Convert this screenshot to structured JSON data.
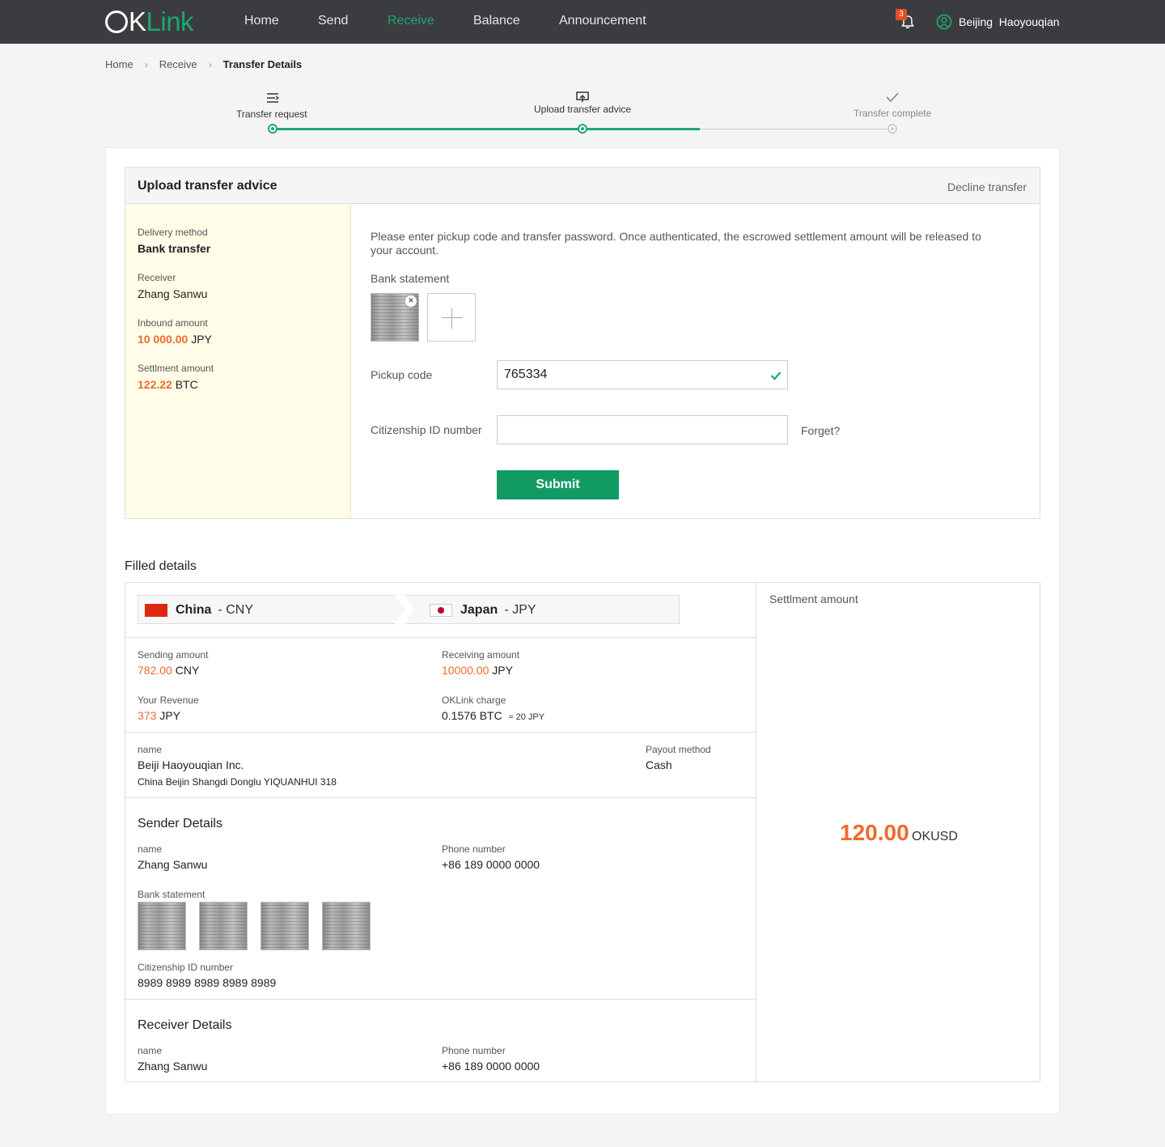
{
  "nav": {
    "logo": {
      "o": "O",
      "k": "K",
      "link": "Link"
    },
    "items": [
      "Home",
      "Send",
      "Receive",
      "Balance",
      "Announcement"
    ],
    "active_index": 2,
    "notification_count": "3",
    "user_name": "Beijing  Haoyouqian",
    "accent_color": "#1ea672"
  },
  "breadcrumb": {
    "home": "Home",
    "receive": "Receive",
    "current": "Transfer Details"
  },
  "steps": [
    {
      "label": "Transfer request",
      "icon": "list-transfer-icon",
      "status": "done"
    },
    {
      "label": "Upload transfer advice",
      "icon": "upload-advice-icon",
      "status": "current"
    },
    {
      "label": "Transfer complete",
      "icon": "checkmark-icon",
      "status": "todo"
    }
  ],
  "upload": {
    "title": "Upload transfer advice",
    "decline": "Decline transfer",
    "delivery_method_label": "Delivery method",
    "delivery_method": "Bank transfer",
    "receiver_label": "Receiver",
    "receiver": "Zhang Sanwu",
    "inbound_label": "Inbound amount",
    "inbound_amount": "10 000.00",
    "inbound_currency": "JPY",
    "settlement_label": "Settlment amount",
    "settlement_amount": "122.22",
    "settlement_currency": "BTC",
    "instructions": "Please enter pickup code and transfer password. Once authenticated, the escrowed settlement amount will be released to your account.",
    "bank_statement_label": "Bank statement",
    "pickup_label": "Pickup code",
    "pickup_value": "765334",
    "citizen_label": "Citizenship ID number",
    "citizen_value": "",
    "forget": "Forget?",
    "submit": "Submit"
  },
  "filled": {
    "title": "Filled details",
    "from_country": "China",
    "from_currency": " - CNY",
    "to_country": "Japan",
    "to_currency": " - JPY",
    "sending_label": "Sending amount",
    "sending_amount": "782.00",
    "sending_currency": "CNY",
    "receiving_label": "Receiving amount",
    "receiving_amount": "10000.00",
    "receiving_currency": "JPY",
    "revenue_label": "Your Revenue",
    "revenue_amount": "373",
    "revenue_currency": "JPY",
    "charge_label": "OKLink charge",
    "charge_value": "0.1576 BTC",
    "charge_approx": "≈ 20 JPY",
    "name_label": "name",
    "company_name": "Beiji Haoyouqian Inc.",
    "company_address": "China  Beijin  Shangdi Donglu YIQUANHUI 318",
    "payout_label": "Payout method",
    "payout_value": "Cash",
    "sender_title": "Sender Details",
    "sender_name_label": "name",
    "sender_name": "Zhang Sanwu",
    "sender_phone_label": "Phone number",
    "sender_phone": "+86 189 0000 0000",
    "sender_bank_label": "Bank statement",
    "sender_id_label": "Citizenship ID number",
    "sender_id": "8989 8989 8989 8989 8989",
    "receiver_title": "Receiver Details",
    "receiver_name_label": "name",
    "receiver_name": "Zhang Sanwu",
    "receiver_phone_label": "Phone number",
    "receiver_phone": "+86 189 0000 0000",
    "settlement_label": "Settlment amount",
    "settlement_value": "120.00",
    "settlement_unit": "OKUSD"
  }
}
